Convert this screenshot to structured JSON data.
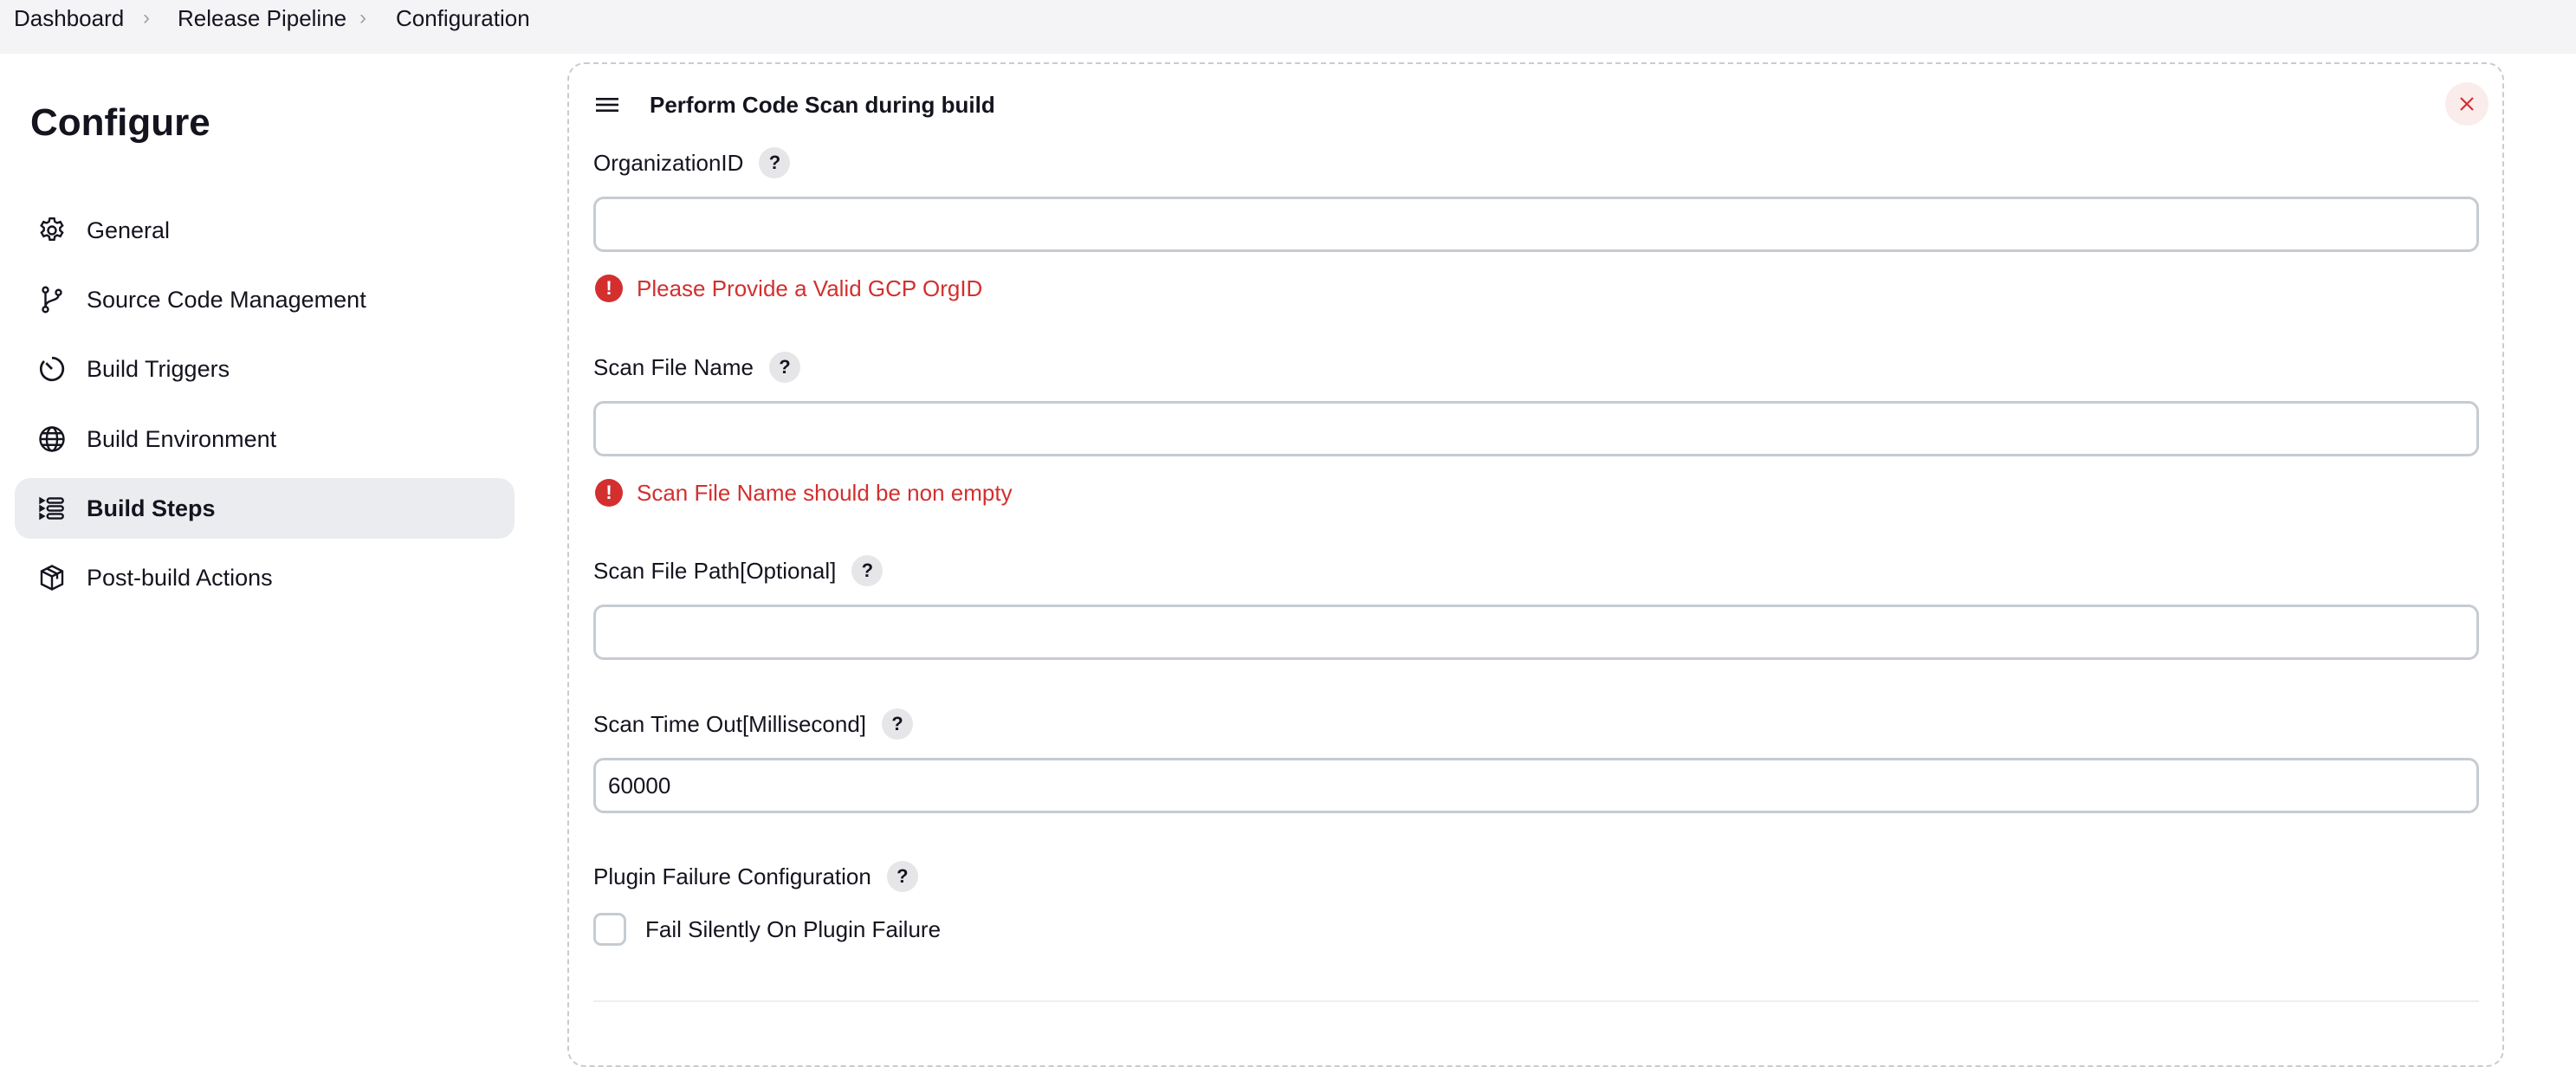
{
  "breadcrumb": {
    "items": [
      "Dashboard",
      "Release Pipeline",
      "Configuration"
    ],
    "separator": "›"
  },
  "sidebar": {
    "title": "Configure",
    "items": [
      {
        "label": "General",
        "icon": "gear-icon",
        "active": false
      },
      {
        "label": "Source Code Management",
        "icon": "git-branch-icon",
        "active": false
      },
      {
        "label": "Build Triggers",
        "icon": "timer-icon",
        "active": false
      },
      {
        "label": "Build Environment",
        "icon": "globe-icon",
        "active": false
      },
      {
        "label": "Build Steps",
        "icon": "list-steps-icon",
        "active": true
      },
      {
        "label": "Post-build Actions",
        "icon": "package-icon",
        "active": false
      }
    ]
  },
  "build_step": {
    "title": "Perform Code Scan during build",
    "close_label": "×",
    "help_label": "?",
    "fields": {
      "organization_id": {
        "label": "OrganizationID",
        "value": "",
        "error": "Please Provide a Valid GCP OrgID"
      },
      "scan_file_name": {
        "label": "Scan File Name",
        "value": "",
        "error": "Scan File Name should be non empty"
      },
      "scan_file_path": {
        "label": "Scan File Path[Optional]",
        "value": ""
      },
      "scan_time_out": {
        "label": "Scan Time Out[Millisecond]",
        "value": "60000"
      },
      "plugin_failure": {
        "label": "Plugin Failure Configuration",
        "checkbox_label": "Fail Silently On Plugin Failure",
        "checked": false
      }
    }
  },
  "colors": {
    "error": "#d32f2f",
    "active_item_bg": "#ebecf0",
    "breadcrumb_bg": "#f4f4f7",
    "input_border": "#c6ccd1"
  }
}
